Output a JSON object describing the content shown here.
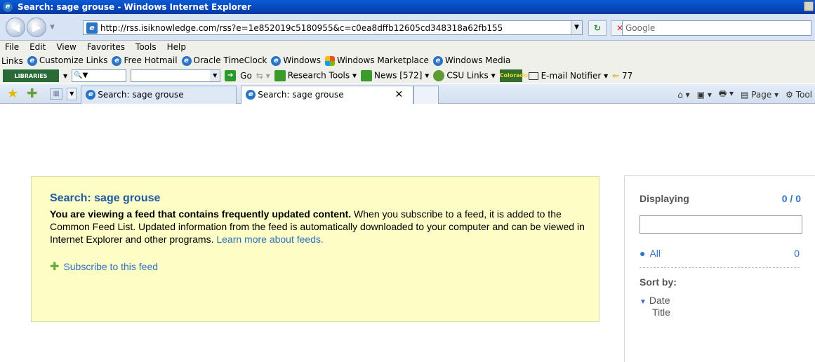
{
  "window": {
    "title": "Search: sage grouse - Windows Internet Explorer"
  },
  "address": {
    "url": "http://rss.isiknowledge.com/rss?e=1e852019c5180955&c=c0ea8dffb12605cd348318a62fb155",
    "search_placeholder": "Google"
  },
  "menu": [
    "File",
    "Edit",
    "View",
    "Favorites",
    "Tools",
    "Help"
  ],
  "links": {
    "label": "Links",
    "items": [
      "Customize Links",
      "Free Hotmail",
      "Oracle TimeClock",
      "Windows",
      "Windows Marketplace",
      "Windows Media"
    ]
  },
  "toolbar": {
    "libraries_label": "LIBRARIES",
    "go_label": "Go",
    "research_tools": "Research Tools",
    "news": "News [572]",
    "csu_links": "CSU Links",
    "colorado_state": "Colorado State",
    "email_notifier": "E-mail Notifier",
    "extra": "77"
  },
  "tabs": [
    {
      "label": "Search: sage grouse"
    },
    {
      "label": "Search: sage grouse"
    }
  ],
  "right_tools": {
    "page": "Page",
    "tools": "Tool"
  },
  "feed": {
    "title": "Search: sage grouse",
    "bold_intro": "You are viewing a feed that contains frequently updated content.",
    "description": " When you subscribe to a feed, it is added to the Common Feed List. Updated information from the feed is automatically downloaded to your computer and can be viewed in Internet Explorer and other programs. ",
    "learn_more": "Learn more about feeds.",
    "subscribe": "Subscribe to this feed"
  },
  "sidebar": {
    "displaying": "Displaying",
    "count": "0 / 0",
    "filter_value": "",
    "all_label": "All",
    "all_count": "0",
    "sort_by": "Sort by:",
    "sort_date": "Date",
    "sort_title": "Title"
  }
}
